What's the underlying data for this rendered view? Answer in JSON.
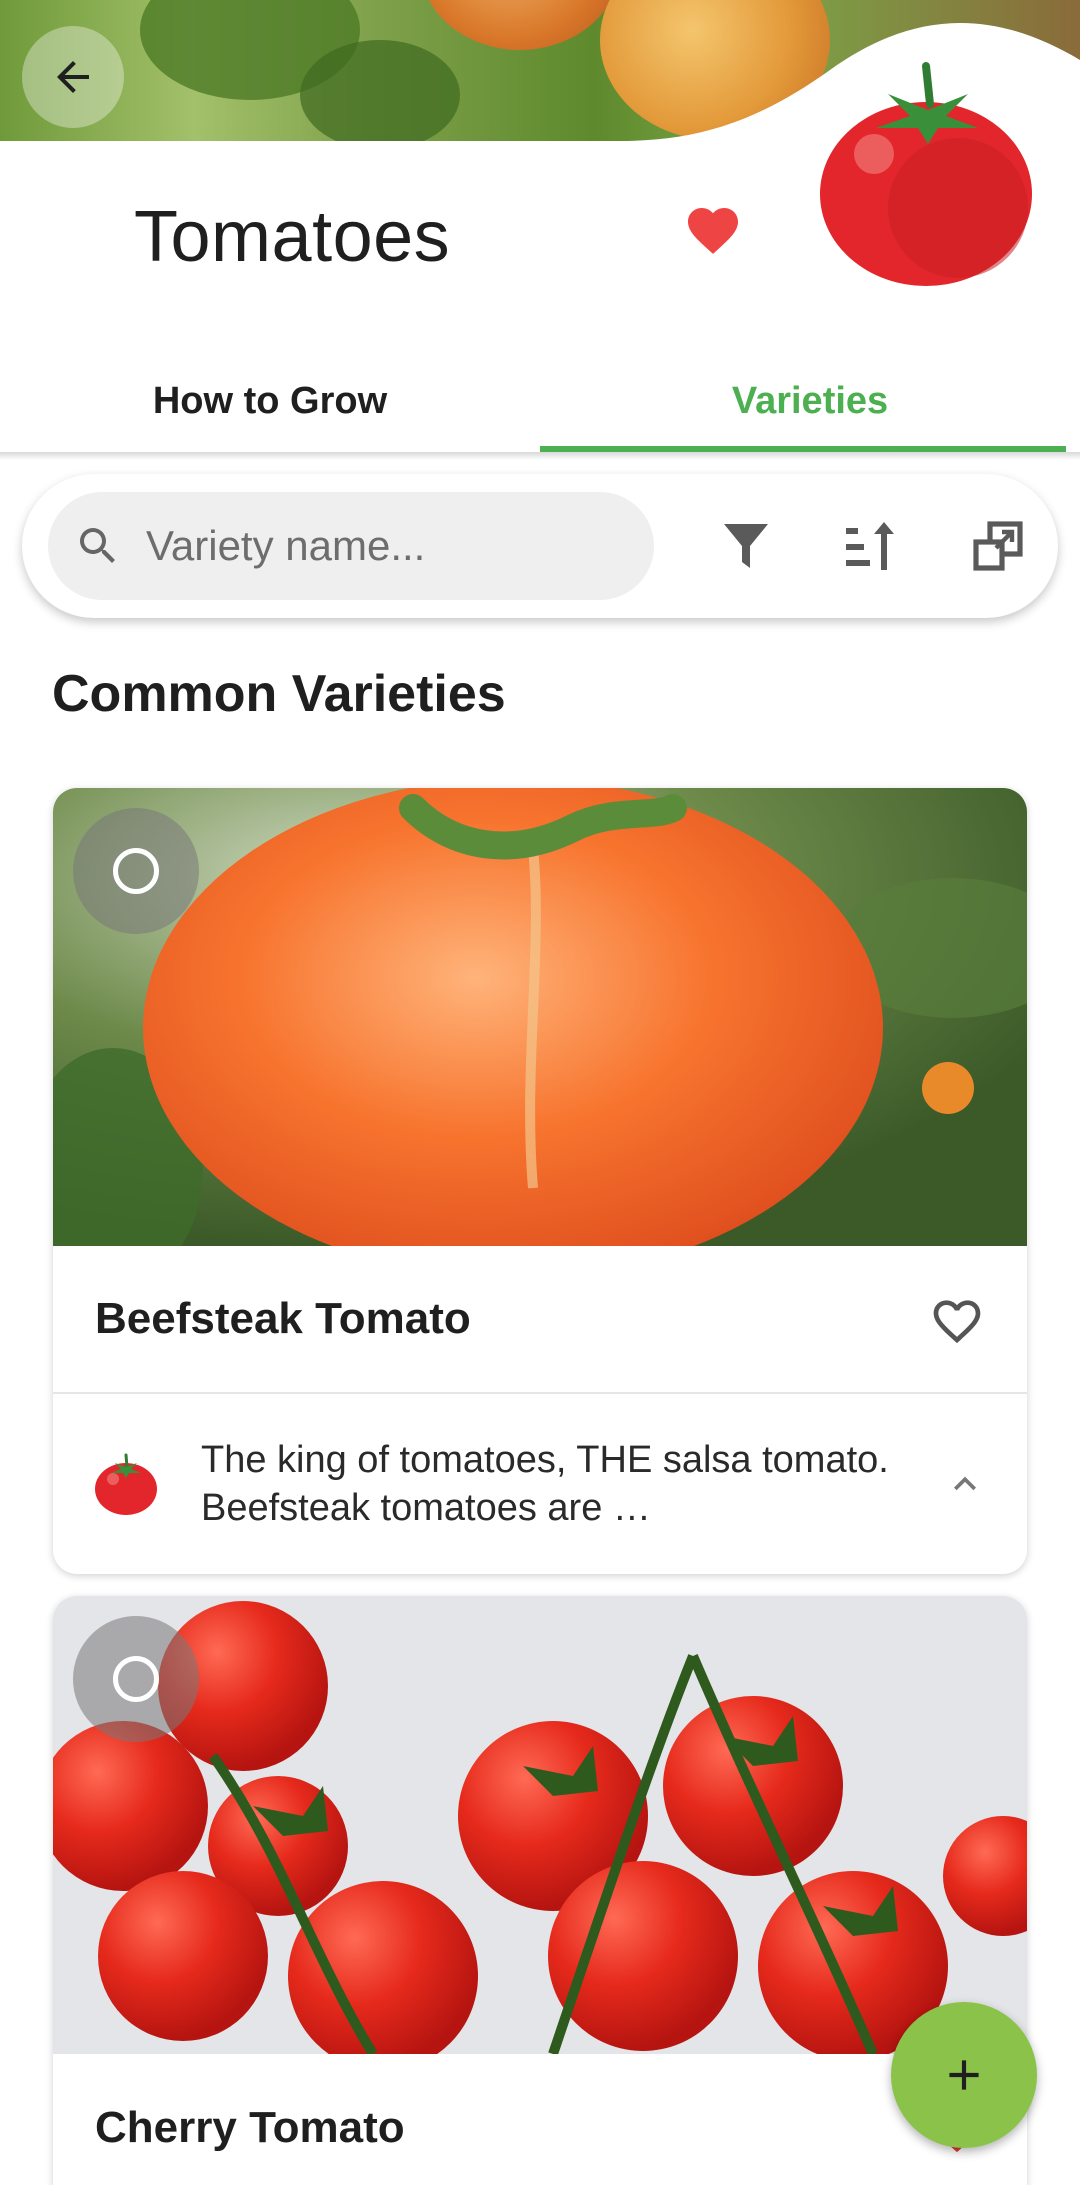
{
  "header": {
    "title": "Tomatoes",
    "back_icon": "arrow-back-icon",
    "favorite_icon": "heart-filled-icon",
    "favorite_color": "#ef4444",
    "plant_icon": "tomato-icon"
  },
  "tabs": [
    {
      "label": "How to Grow",
      "active": false
    },
    {
      "label": "Varieties",
      "active": true
    }
  ],
  "accent_color": "#4caf50",
  "search": {
    "placeholder": "Variety name...",
    "value": "",
    "search_icon": "search-icon",
    "filter_icon": "filter-icon",
    "sort_icon": "sort-icon",
    "compare_icon": "compare-icon"
  },
  "section": {
    "title": "Common Varieties"
  },
  "varieties": [
    {
      "name": "Beefsteak Tomato",
      "description": "The king of tomatoes, THE salsa tomato. Beefsteak tomatoes are …",
      "favorite_icon": "heart-outline-icon",
      "expand_icon": "chevron-up-icon",
      "selected": false
    },
    {
      "name": "Cherry Tomato",
      "favorite_icon": "heart-filled-icon",
      "selected": false
    }
  ],
  "fab": {
    "icon": "plus-icon",
    "color": "#8bc34a"
  }
}
